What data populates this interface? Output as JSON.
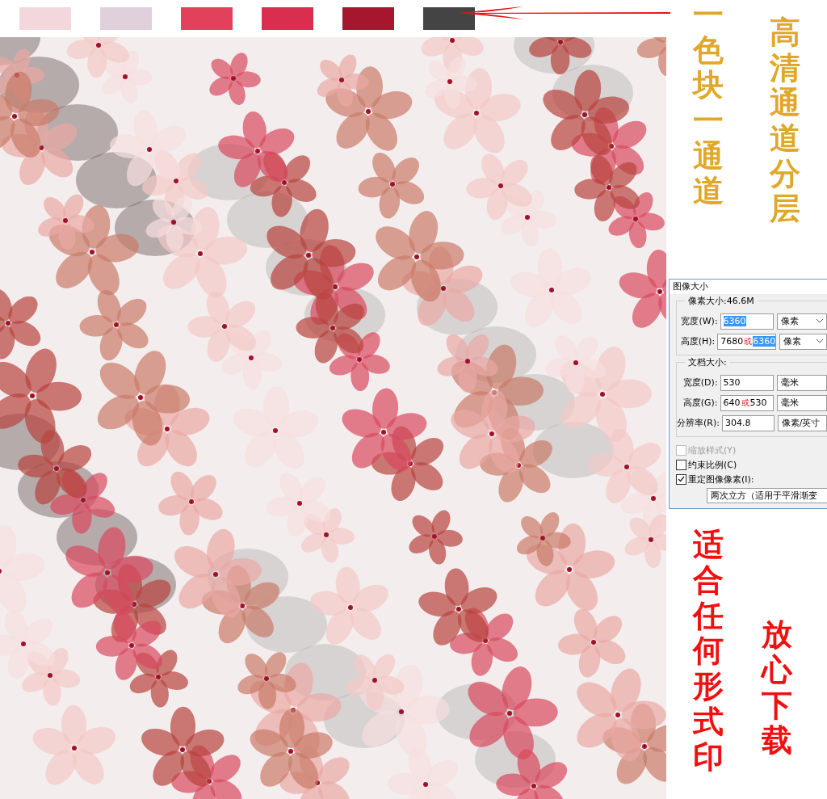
{
  "swatches": [
    {
      "color": "#f3d7dc"
    },
    {
      "color": "#e0d0dc"
    },
    {
      "color": "#e2415c"
    },
    {
      "color": "#d92e50"
    },
    {
      "color": "#a6162e"
    },
    {
      "color": "#444444"
    }
  ],
  "top_texts": [
    "一色块一通道",
    "高清通道分层"
  ],
  "dialog": {
    "title": "图像大小",
    "groups": [
      {
        "legend": "像素大小:46.6M",
        "rows": [
          {
            "label": "宽度(W):",
            "parts": [
              {
                "kind": "selected",
                "text": "6360"
              }
            ],
            "unit": "像素"
          },
          {
            "label": "高度(H):",
            "parts": [
              {
                "kind": "plain",
                "text": "7680"
              },
              {
                "kind": "note",
                "text": "或"
              },
              {
                "kind": "selected",
                "text": "6360"
              }
            ],
            "unit": "像素"
          }
        ]
      },
      {
        "legend": "文档大小:",
        "rows": [
          {
            "label": "宽度(D):",
            "parts": [
              {
                "kind": "plain",
                "text": "530"
              }
            ],
            "unit": "毫米"
          },
          {
            "label": "高度(G):",
            "parts": [
              {
                "kind": "plain",
                "text": "640"
              },
              {
                "kind": "note",
                "text": "或"
              },
              {
                "kind": "plain",
                "text": "530"
              }
            ],
            "unit": "毫米"
          },
          {
            "label": "分辨率(R):",
            "parts": [
              {
                "kind": "plain",
                "text": "304.8"
              }
            ],
            "unit": "像素/英寸"
          }
        ]
      }
    ],
    "checkboxes": [
      {
        "label": "缩放样式(Y)",
        "checked": false,
        "disabled": true
      },
      {
        "label": "约束比例(C)",
        "checked": false,
        "disabled": false
      },
      {
        "label": "重定图像像素(I):",
        "checked": true,
        "disabled": false
      }
    ],
    "resample": "两次立方（适用于平滑渐变"
  },
  "bottom_texts": [
    "适合任何形式印",
    "放心下载"
  ]
}
